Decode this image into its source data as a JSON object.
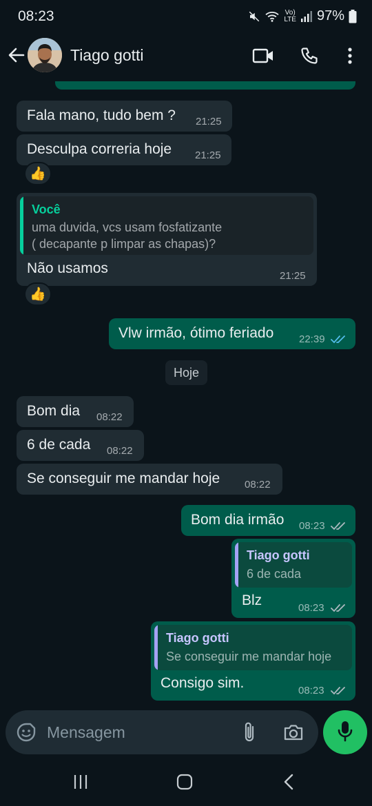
{
  "status_bar": {
    "time": "08:23",
    "battery": "97%",
    "network": "LTE"
  },
  "header": {
    "contact_name": "Tiago gotti"
  },
  "colors": {
    "incoming": "#202c33",
    "outgoing": "#005c4b",
    "accent": "#21c063",
    "read_ticks": "#53bdeb",
    "quote_you": "#06cf9c",
    "quote_contact": "#a5a2f5"
  },
  "messages": [
    {
      "direction": "in",
      "text": "Fala mano, tudo bem ?",
      "time": "21:25"
    },
    {
      "direction": "in",
      "text": "Desculpa correria hoje",
      "time": "21:25",
      "reaction": "👍"
    },
    {
      "direction": "in",
      "quote_name": "Você",
      "quote_line1": "uma duvida, vcs usam fosfatizante",
      "quote_line2": "( decapante p limpar as chapas)?",
      "text": "Não usamos",
      "time": "21:25",
      "reaction": "👍"
    },
    {
      "direction": "out",
      "text": "Vlw irmão, ótimo  feriado",
      "time": "22:39",
      "status": "read"
    },
    {
      "date_separator": "Hoje"
    },
    {
      "direction": "in",
      "text": "Bom dia",
      "time": "08:22"
    },
    {
      "direction": "in",
      "text": "6 de cada",
      "time": "08:22"
    },
    {
      "direction": "in",
      "text": "Se conseguir me mandar hoje",
      "time": "08:22"
    },
    {
      "direction": "out",
      "text": "Bom dia irmão",
      "time": "08:23",
      "status": "delivered"
    },
    {
      "direction": "out",
      "quote_name": "Tiago gotti",
      "quote_text": "6 de cada",
      "text": "Blz",
      "time": "08:23",
      "status": "delivered"
    },
    {
      "direction": "out",
      "quote_name": "Tiago gotti",
      "quote_text": "Se conseguir me mandar hoje",
      "text": "Consigo sim.",
      "time": "08:23",
      "status": "delivered"
    }
  ],
  "composer": {
    "placeholder": "Mensagem"
  }
}
